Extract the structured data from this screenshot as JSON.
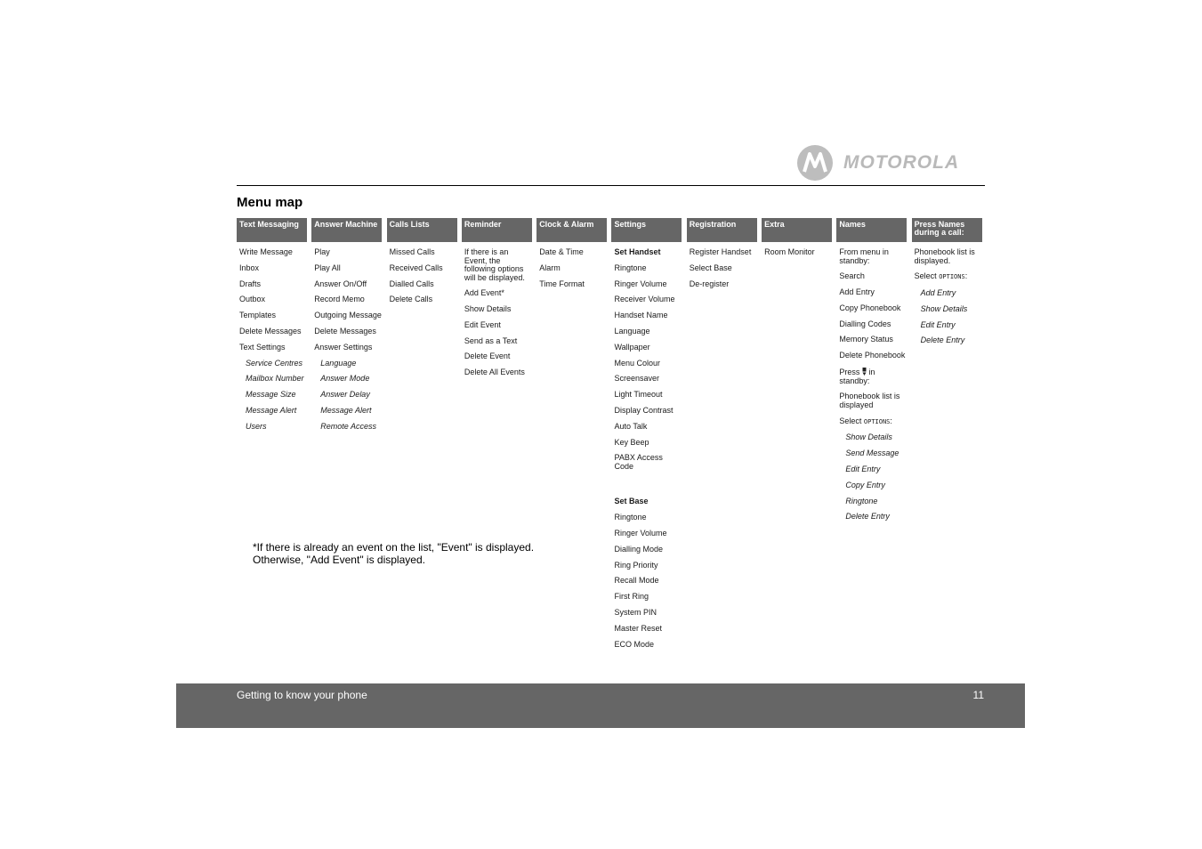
{
  "brand": {
    "name": "MOTOROLA"
  },
  "page_title": "Menu map",
  "columns": [
    {
      "header": "Text Messaging",
      "items": [
        {
          "text": "Write Message"
        },
        {
          "text": "Inbox"
        },
        {
          "text": "Drafts"
        },
        {
          "text": "Outbox"
        },
        {
          "text": "Templates"
        },
        {
          "text": "Delete Messages"
        },
        {
          "text": "Text Settings"
        },
        {
          "text": "Service Centres",
          "style": "sub"
        },
        {
          "text": "Mailbox Number",
          "style": "sub"
        },
        {
          "text": "Message Size",
          "style": "sub"
        },
        {
          "text": "Message Alert",
          "style": "sub"
        },
        {
          "text": "Users",
          "style": "sub"
        }
      ]
    },
    {
      "header": "Answer Machine",
      "items": [
        {
          "text": "Play"
        },
        {
          "text": "Play All"
        },
        {
          "text": "Answer On/Off"
        },
        {
          "text": "Record Memo"
        },
        {
          "text": "Outgoing Message"
        },
        {
          "text": "Delete Messages"
        },
        {
          "text": "Answer Settings"
        },
        {
          "text": "Language",
          "style": "sub"
        },
        {
          "text": "Answer Mode",
          "style": "sub"
        },
        {
          "text": "Answer Delay",
          "style": "sub"
        },
        {
          "text": "Message Alert",
          "style": "sub"
        },
        {
          "text": "Remote Access",
          "style": "sub"
        }
      ]
    },
    {
      "header": "Calls Lists",
      "items": [
        {
          "text": "Missed Calls"
        },
        {
          "text": "Received Calls"
        },
        {
          "text": "Dialled Calls"
        },
        {
          "text": "Delete Calls"
        }
      ]
    },
    {
      "header": "Reminder",
      "items": [
        {
          "text": "If there is an Event, the following options will be displayed."
        },
        {
          "text": "Add Event*"
        },
        {
          "text": "Show Details"
        },
        {
          "text": "Edit Event"
        },
        {
          "text": "Send as a Text"
        },
        {
          "text": "Delete Event"
        },
        {
          "text": "Delete All Events"
        }
      ]
    },
    {
      "header": "Clock & Alarm",
      "items": [
        {
          "text": "Date & Time"
        },
        {
          "text": "Alarm"
        },
        {
          "text": "Time Format"
        }
      ]
    },
    {
      "header": "Settings",
      "items": [
        {
          "text": "Set Handset",
          "style": "bold"
        },
        {
          "text": "Ringtone"
        },
        {
          "text": "Ringer Volume"
        },
        {
          "text": "Receiver Volume"
        },
        {
          "text": "Handset Name"
        },
        {
          "text": "Language"
        },
        {
          "text": "Wallpaper"
        },
        {
          "text": "Menu Colour"
        },
        {
          "text": "Screensaver"
        },
        {
          "text": "Light Timeout"
        },
        {
          "text": "Display Contrast"
        },
        {
          "text": "Auto Talk"
        },
        {
          "text": "Key Beep"
        },
        {
          "text": "PABX Access Code"
        },
        {
          "text": "Set Base",
          "style": "bold gap"
        },
        {
          "text": "Ringtone"
        },
        {
          "text": "Ringer Volume"
        },
        {
          "text": "Dialling Mode"
        },
        {
          "text": "Ring Priority"
        },
        {
          "text": "Recall Mode"
        },
        {
          "text": "First Ring"
        },
        {
          "text": "System PIN"
        },
        {
          "text": "Master Reset"
        },
        {
          "text": "ECO Mode"
        }
      ]
    },
    {
      "header": "Registration",
      "items": [
        {
          "text": "Register Handset"
        },
        {
          "text": "Select Base"
        },
        {
          "text": "De-register"
        }
      ]
    },
    {
      "header": "Extra",
      "items": [
        {
          "text": "Room Monitor"
        }
      ]
    },
    {
      "header": "Names",
      "items": [
        {
          "text": "From menu in standby:"
        },
        {
          "text": "Search"
        },
        {
          "text": "Add Entry"
        },
        {
          "text": "Copy Phonebook"
        },
        {
          "text": "Dialling Codes"
        },
        {
          "text": "Memory Status"
        },
        {
          "text": "Delete Phonebook"
        },
        {
          "text": "Press",
          "icon": "mic-key-icon",
          "suffix": " in standby:"
        },
        {
          "text": "Phonebook list is displayed"
        },
        {
          "text": "Select ",
          "caps": "OPTIONS",
          "suffix": ":"
        },
        {
          "text": "Show Details",
          "style": "sub"
        },
        {
          "text": "Send Message",
          "style": "sub"
        },
        {
          "text": "Edit Entry",
          "style": "sub"
        },
        {
          "text": "Copy Entry",
          "style": "sub"
        },
        {
          "text": "Ringtone",
          "style": "sub"
        },
        {
          "text": "Delete Entry",
          "style": "sub"
        }
      ]
    },
    {
      "header": "Press Names during a call:",
      "items": [
        {
          "text": "Phonebook list is displayed."
        },
        {
          "text": "Select ",
          "caps": "OPTIONS",
          "suffix": ":"
        },
        {
          "text": "Add Entry",
          "style": "sub"
        },
        {
          "text": "Show Details",
          "style": "sub"
        },
        {
          "text": "Edit Entry",
          "style": "sub"
        },
        {
          "text": "Delete Entry",
          "style": "sub"
        }
      ]
    }
  ],
  "footnote": {
    "line1": "*If there is already an event on the list, \"Event\" is displayed.",
    "line2": "Otherwise, \"Add Event\" is displayed."
  },
  "footer": {
    "section": "Getting to know your phone",
    "page_number": "11"
  },
  "colors": {
    "header_bg": "#666666",
    "footer_bg": "#666666",
    "logo_gray": "#bdbdbd"
  }
}
